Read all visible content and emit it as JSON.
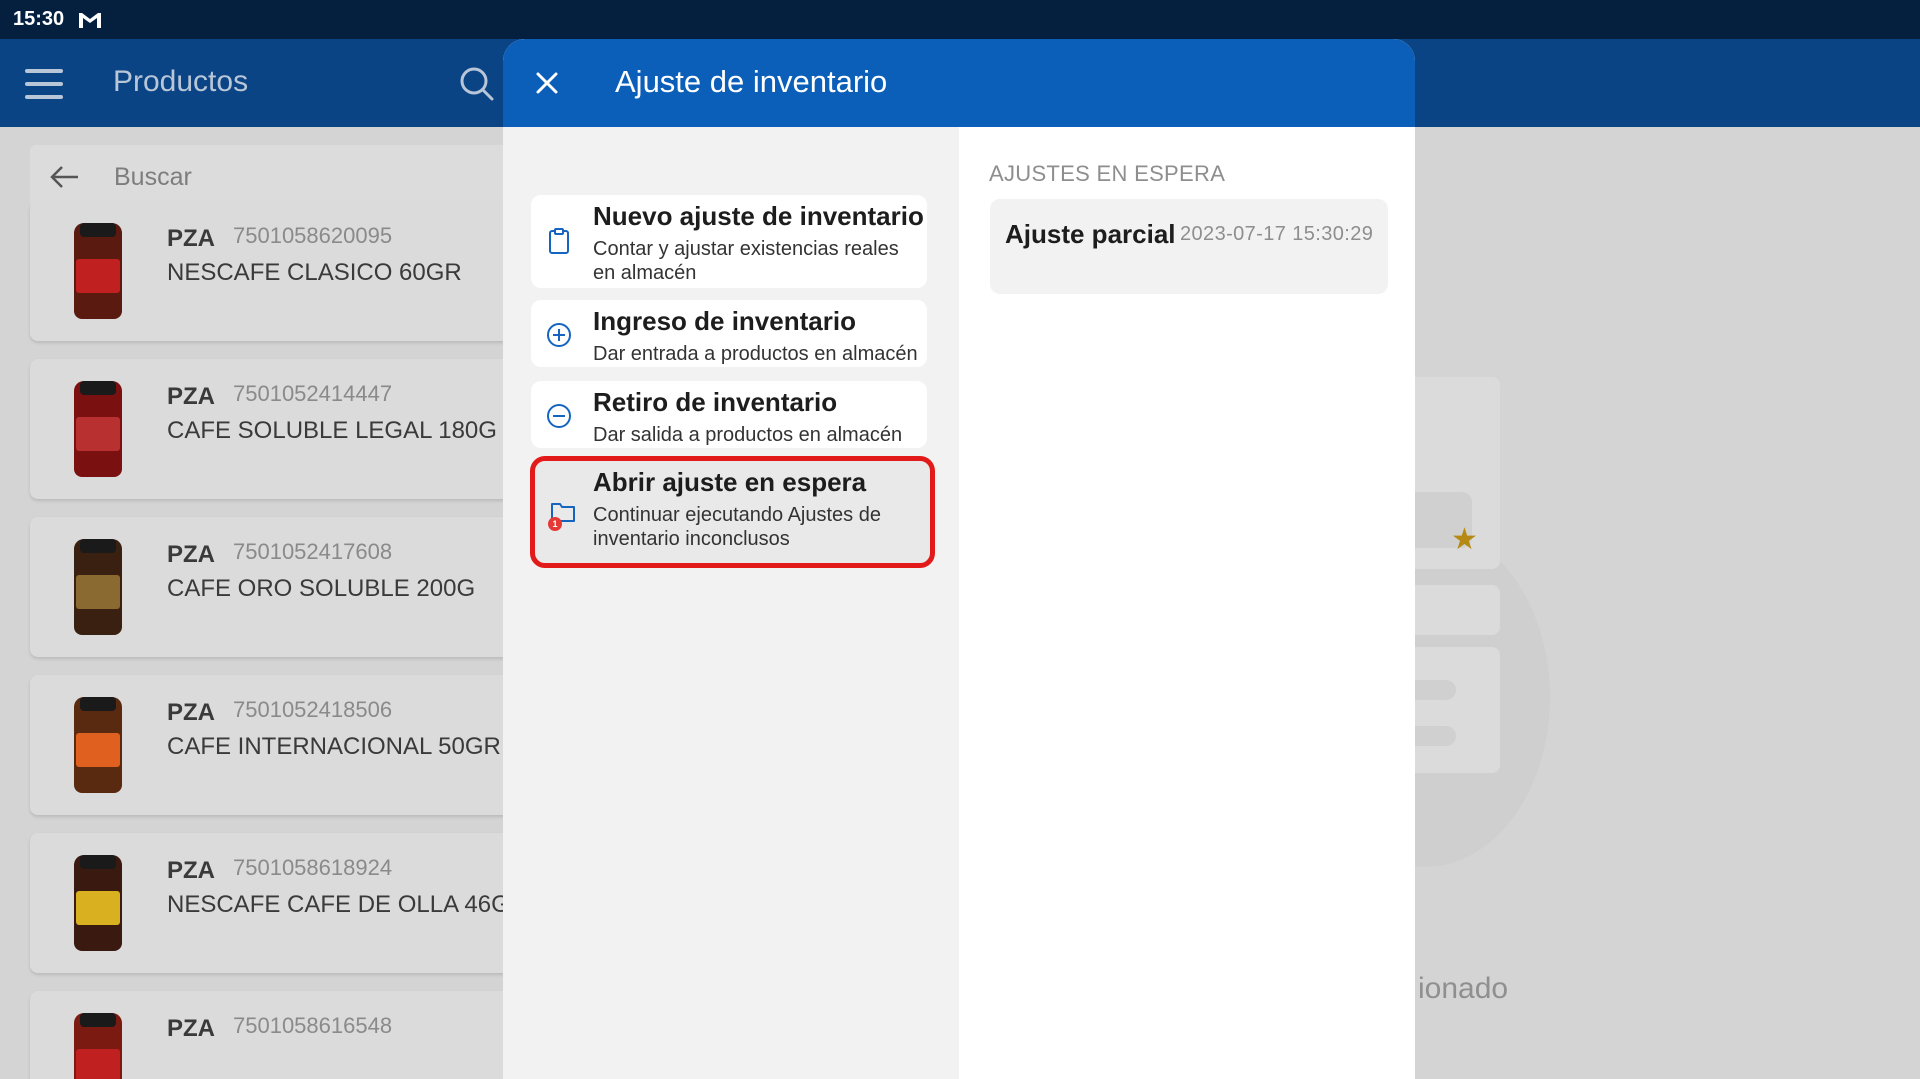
{
  "status_bar": {
    "time": "15:30",
    "notification_icon": "gmail-icon"
  },
  "app_bar": {
    "title": "Productos",
    "menu_icon": "menu-icon",
    "search_icon": "search-icon"
  },
  "search": {
    "back_icon": "arrow-left-icon",
    "placeholder": "Buscar"
  },
  "products": [
    {
      "unit": "PZA",
      "code": "7501058620095",
      "name": "NESCAFE CLASICO 60GR",
      "thumb_color": "#5a1a10",
      "label_color": "#c02020"
    },
    {
      "unit": "PZA",
      "code": "7501052414447",
      "name": "CAFE SOLUBLE LEGAL 180G",
      "thumb_color": "#7a1010",
      "label_color": "#b83030"
    },
    {
      "unit": "PZA",
      "code": "7501052417608",
      "name": "CAFE ORO SOLUBLE 200G",
      "thumb_color": "#3a2010",
      "label_color": "#8a6a30"
    },
    {
      "unit": "PZA",
      "code": "7501052418506",
      "name": "CAFE INTERNACIONAL 50GR",
      "thumb_color": "#5a2a10",
      "label_color": "#e06020"
    },
    {
      "unit": "PZA",
      "code": "7501058618924",
      "name": "NESCAFE CAFE DE OLLA 46G",
      "thumb_color": "#3a1a10",
      "label_color": "#d8b020"
    },
    {
      "unit": "PZA",
      "code": "7501058616548",
      "name": "",
      "thumb_color": "#7a1a10",
      "label_color": "#c02020"
    }
  ],
  "background_panel": {
    "partial_text": "ionado",
    "star_icon": "star-icon",
    "box_icon": "cube-icon"
  },
  "modal": {
    "title": "Ajuste de inventario",
    "close_icon": "close-icon",
    "options": [
      {
        "title": "Nuevo ajuste de inventario",
        "description": "Contar y ajustar existencias reales en almacén",
        "icon": "clipboard-icon"
      },
      {
        "title": "Ingreso de inventario",
        "description": "Dar entrada a productos en almacén",
        "icon": "plus-circle-icon"
      },
      {
        "title": "Retiro de inventario",
        "description": "Dar salida a productos en almacén",
        "icon": "minus-circle-icon"
      },
      {
        "title": "Abrir ajuste en espera",
        "description": "Continuar ejecutando Ajustes de inventario inconclusos",
        "icon": "folder-icon",
        "badge": "1"
      }
    ],
    "pending_section_title": "AJUSTES EN ESPERA",
    "pending": [
      {
        "name": "Ajuste parcial",
        "date": "2023-07-17 15:30:29"
      }
    ]
  },
  "colors": {
    "status_bar": "#05203f",
    "app_bar": "#0a4485",
    "modal_header": "#0b5fb8",
    "icon_blue": "#1565c0",
    "highlight_border": "#e31a1a"
  }
}
